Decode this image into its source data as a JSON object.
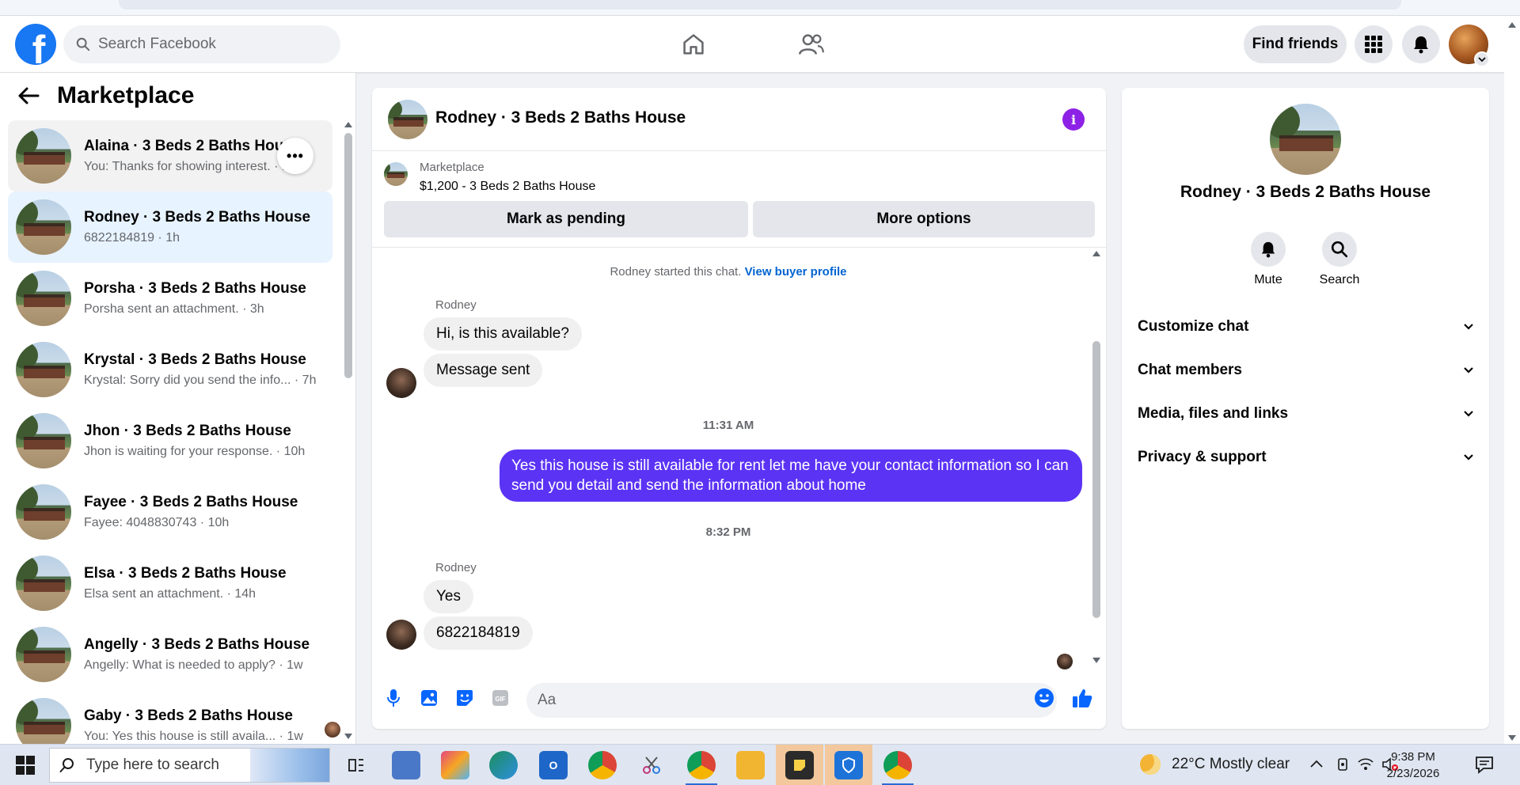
{
  "topbar": {
    "search_placeholder": "Search Facebook",
    "find_friends": "Find friends"
  },
  "sidebar": {
    "title": "Marketplace",
    "conversations": [
      {
        "name": "Alaina · 3 Beds 2 Baths House",
        "preview": "You: Thanks for showing interest. · 1m",
        "state": "hover"
      },
      {
        "name": "Rodney · 3 Beds 2 Baths House",
        "preview": "6822184819 · 1h",
        "state": "active"
      },
      {
        "name": "Porsha · 3 Beds 2 Baths House",
        "preview": "Porsha sent an attachment. · 3h",
        "state": ""
      },
      {
        "name": "Krystal · 3 Beds 2 Baths House",
        "preview": "Krystal: Sorry did you send the info... · 7h",
        "state": ""
      },
      {
        "name": "Jhon · 3 Beds 2 Baths House",
        "preview": "Jhon is waiting for your response. · 10h",
        "state": ""
      },
      {
        "name": "Fayee · 3 Beds 2 Baths House",
        "preview": "Fayee: 4048830743 · 10h",
        "state": ""
      },
      {
        "name": "Elsa · 3 Beds 2 Baths House",
        "preview": "Elsa sent an attachment. · 14h",
        "state": ""
      },
      {
        "name": "Angelly · 3 Beds 2 Baths House",
        "preview": "Angelly: What is needed to apply? · 1w",
        "state": ""
      },
      {
        "name": "Gaby · 3 Beds 2 Baths House",
        "preview": "You: Yes this house is still availa... · 1w",
        "state": ""
      }
    ]
  },
  "chat": {
    "title": "Rodney · 3 Beds 2 Baths House",
    "listing_label": "Marketplace",
    "listing_detail": "$1,200 - 3 Beds 2 Baths House",
    "mark_pending": "Mark as pending",
    "more_options": "More options",
    "started_text": "Rodney started this chat.",
    "view_profile": "View buyer profile",
    "sender_name": "Rodney",
    "msg1": "Hi, is this available?",
    "msg2": "Message sent",
    "time1": "11:31 AM",
    "outgoing": "Yes this house is still available for rent let me have your contact information so I can send you detail and send the information about home",
    "time2": "8:32 PM",
    "msg3": "Yes",
    "msg4": "6822184819",
    "composer_placeholder": "Aa"
  },
  "info_panel": {
    "name": "Rodney · 3 Beds 2 Baths House",
    "mute": "Mute",
    "search": "Search",
    "sections": [
      "Customize chat",
      "Chat members",
      "Media, files and links",
      "Privacy & support"
    ]
  },
  "taskbar": {
    "search_text": "Type here to search",
    "weather": "22°C  Mostly clear",
    "time": "9:38 PM",
    "date": "2/23/2026"
  },
  "colors": {
    "fb_blue": "#1877f2",
    "outgoing_bubble": "#5b33f5",
    "info_purple": "#8d22e6",
    "active_conv": "#e7f3ff"
  }
}
